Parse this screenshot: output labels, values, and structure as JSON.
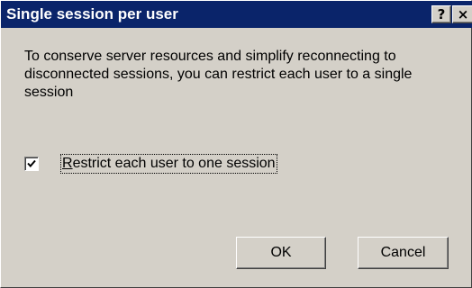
{
  "window": {
    "title": "Single session per user",
    "help_glyph": "?",
    "close_glyph": "×"
  },
  "message": "To conserve server resources and simplify reconnecting to disconnected sessions, you can restrict each user to a single session",
  "option": {
    "checked": true,
    "mnemonic": "R",
    "label_rest": "estrict each user to one session"
  },
  "buttons": {
    "ok_label": "OK",
    "cancel_label": "Cancel"
  },
  "icons": {
    "checkmark": "check-icon"
  },
  "colors": {
    "titlebar": "#0a246a",
    "face": "#d4d0c8"
  }
}
